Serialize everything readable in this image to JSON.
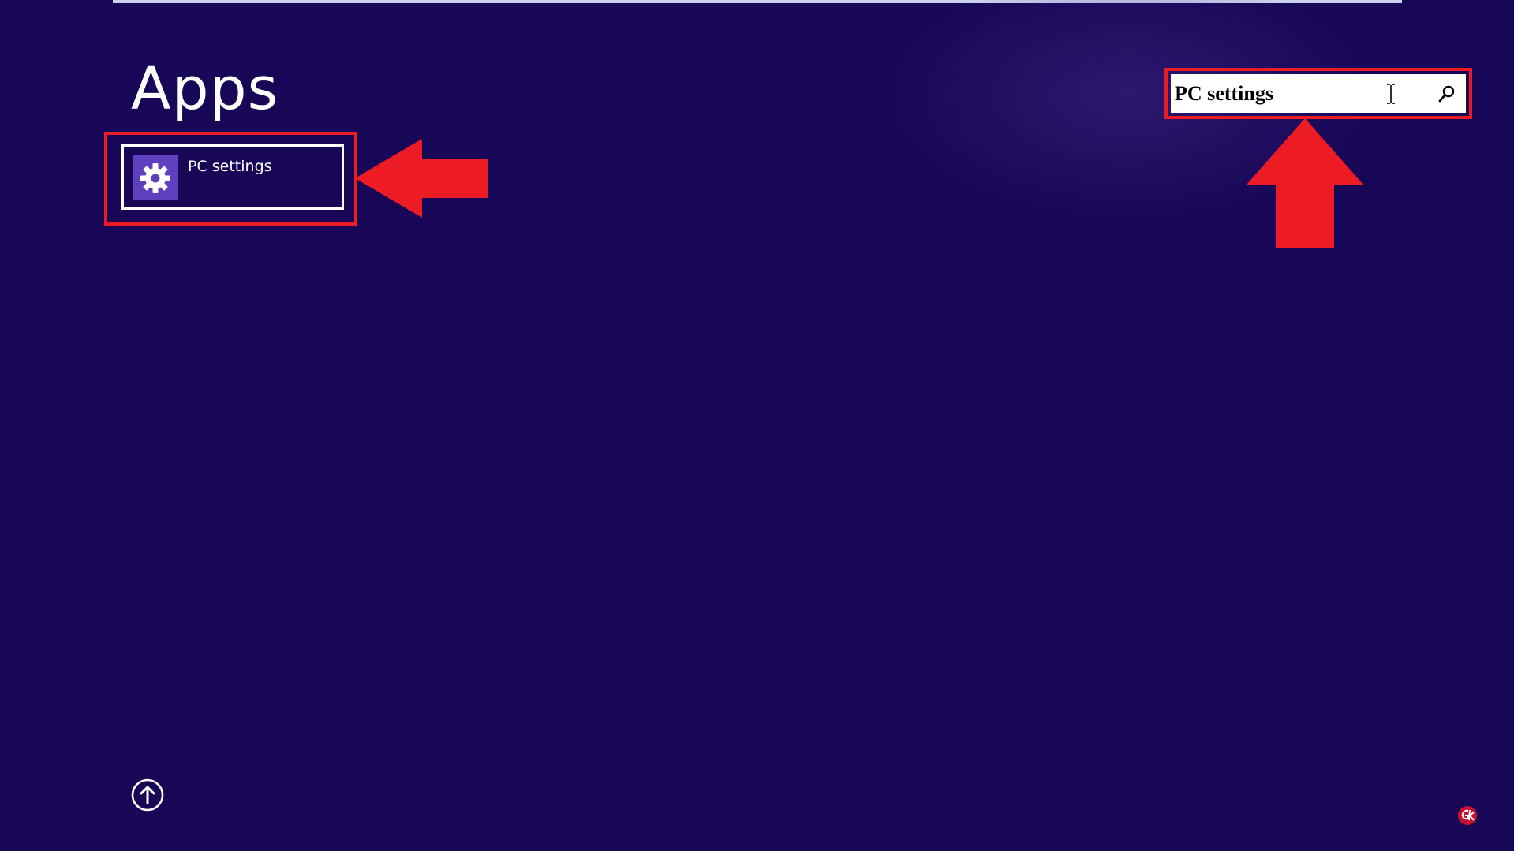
{
  "screen": {
    "title": "Apps",
    "background_color": "#180757",
    "accent_color": "#ed1c24"
  },
  "apps": [
    {
      "label": "PC settings",
      "icon": "gear-icon",
      "tile_color": "#5e3fbd"
    }
  ],
  "search": {
    "value": "PC settings",
    "button_icon": "search-icon"
  },
  "navigation": {
    "scroll_up_icon": "arrow-up-circle-icon"
  },
  "annotations": {
    "arrow_color": "#ed1c24",
    "highlight_color": "#ed1c24"
  }
}
